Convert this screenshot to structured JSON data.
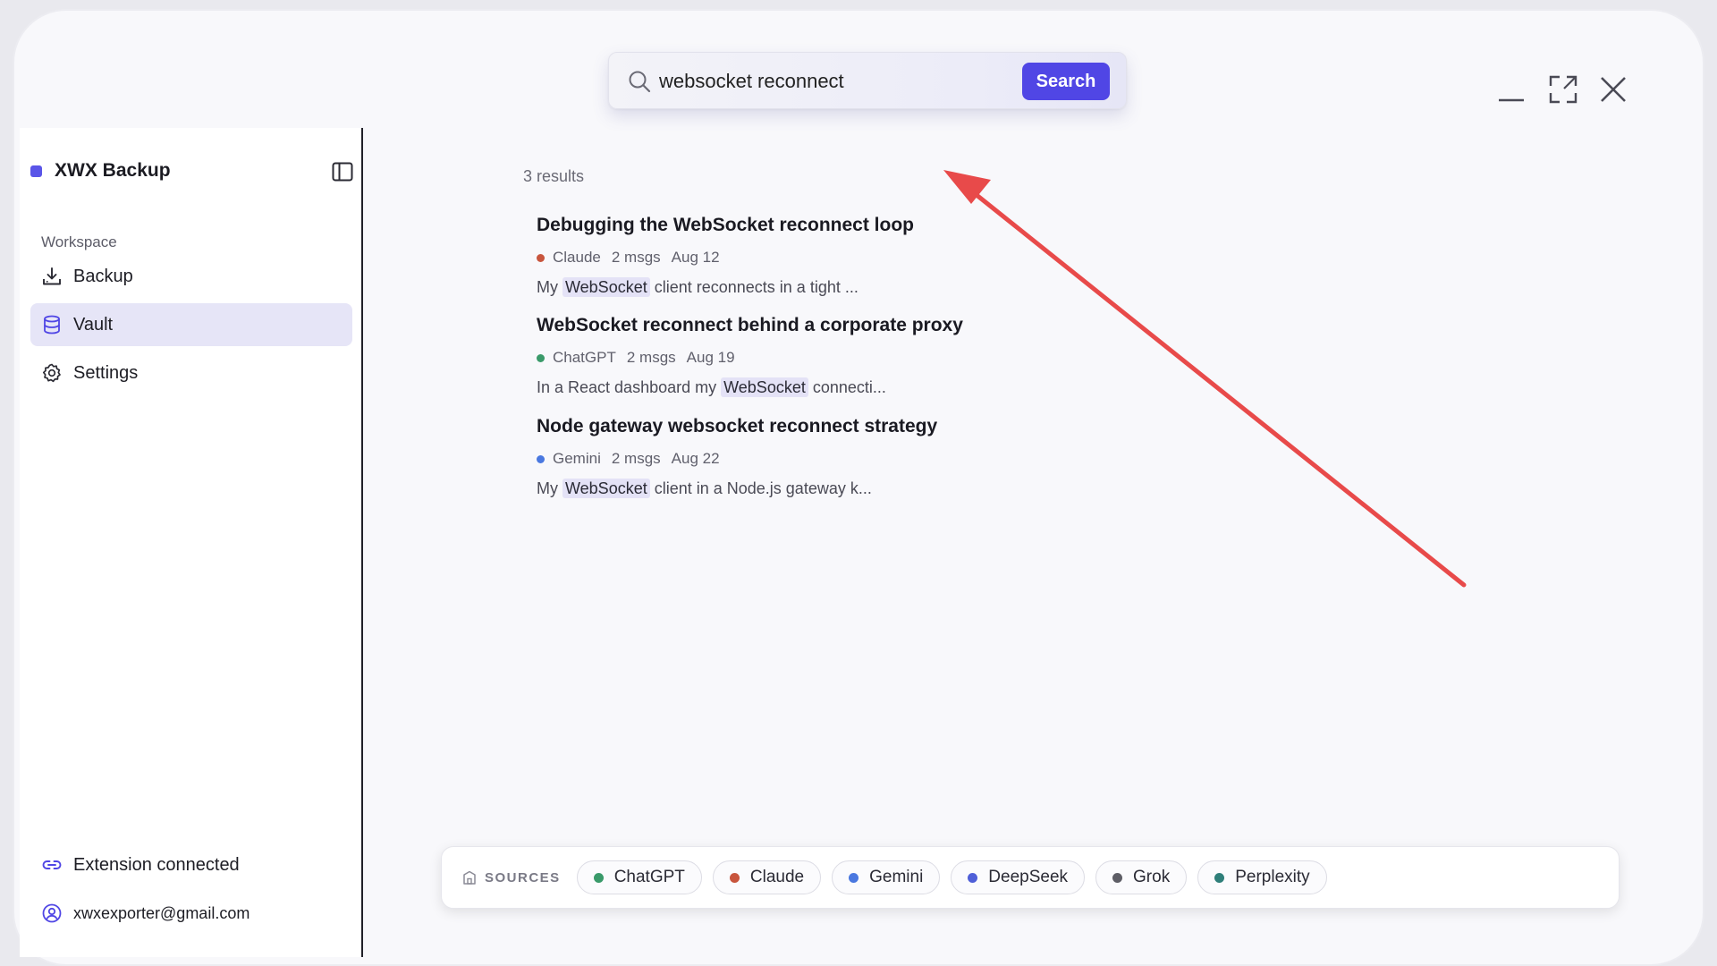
{
  "search": {
    "value": "websocket reconnect",
    "button_label": "Search"
  },
  "window_controls": {
    "minimize_icon": "minimize-icon",
    "maximize_icon": "maximize-icon",
    "close_icon": "close-icon"
  },
  "sidebar": {
    "brand": "XWX Backup",
    "brand_color": "#5a55e8",
    "section": "Workspace",
    "items": [
      {
        "label": "Backup",
        "icon": "download-tray-icon",
        "active": false
      },
      {
        "label": "Vault",
        "icon": "database-icon",
        "active": true
      },
      {
        "label": "Settings",
        "icon": "gear-icon",
        "active": false
      }
    ],
    "extension_status": "Extension connected",
    "user_email": "xwxexporter@gmail.com"
  },
  "results": {
    "count_label": "3 results",
    "items": [
      {
        "title": "Debugging the WebSocket reconnect loop",
        "source": "Claude",
        "source_color": "#c8553d",
        "msgs": "2 msgs",
        "date": "Aug 12",
        "snippet_pre": "My ",
        "snippet_hl": "WebSocket",
        "snippet_post": " client reconnects in a tight ..."
      },
      {
        "title": "WebSocket reconnect behind a corporate proxy",
        "source": "ChatGPT",
        "source_color": "#3a9a6a",
        "msgs": "2 msgs",
        "date": "Aug 19",
        "snippet_pre": "In a React dashboard my ",
        "snippet_hl": "WebSocket",
        "snippet_post": " connecti..."
      },
      {
        "title": "Node gateway websocket reconnect strategy",
        "source": "Gemini",
        "source_color": "#4a78e0",
        "msgs": "2 msgs",
        "date": "Aug 22",
        "snippet_pre": "My ",
        "snippet_hl": "WebSocket",
        "snippet_post": " client in a Node.js gateway k..."
      }
    ]
  },
  "sources": {
    "label": "SOURCES",
    "chips": [
      {
        "label": "ChatGPT",
        "color": "#3a9a6a"
      },
      {
        "label": "Claude",
        "color": "#c8553d"
      },
      {
        "label": "Gemini",
        "color": "#4a78e0"
      },
      {
        "label": "DeepSeek",
        "color": "#4f5fd8"
      },
      {
        "label": "Grok",
        "color": "#5e5e66"
      },
      {
        "label": "Perplexity",
        "color": "#2f7f7a"
      }
    ]
  },
  "annotation": {
    "arrow_color": "#e84a4a"
  }
}
